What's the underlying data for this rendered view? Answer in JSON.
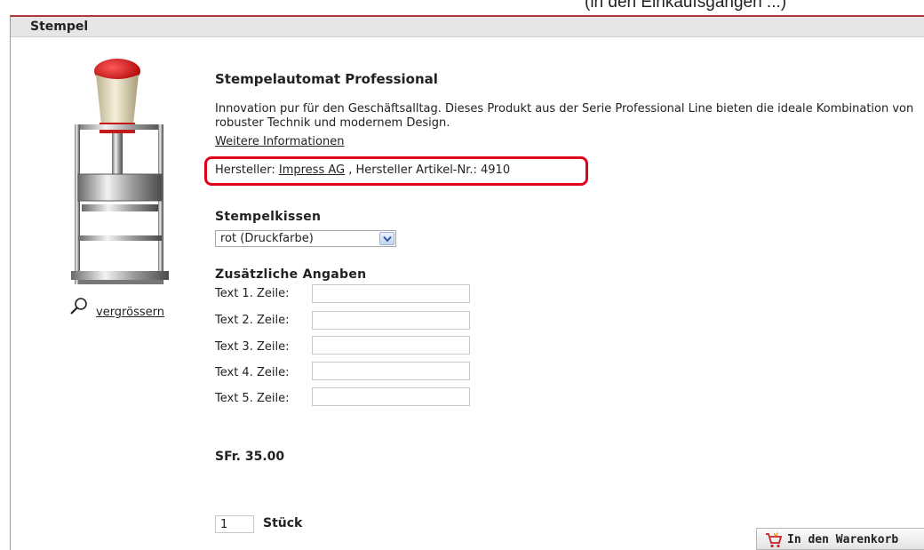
{
  "top_strip_text": "(in den Einkaufsgängen ...)",
  "section": {
    "title": "Stempel"
  },
  "product": {
    "title": "Stempelautomat Professional",
    "description": "Innovation pur für den Geschäftsalltag. Dieses Produkt aus der Serie Professional Line bieten die ideale Kombination von robuster Technik und modernem Design.",
    "more_info_label": "Weitere Informationen",
    "enlarge_label": "vergrössern",
    "image_icon": "rubber-stamp-image",
    "magnifier_icon": "magnifier-icon"
  },
  "manufacturer": {
    "label": "Hersteller:",
    "name": "Impress AG",
    "article_label": ", Hersteller Artikel-Nr.: 4910",
    "highlight_color": "#e0001a"
  },
  "ink_pad": {
    "heading": "Stempelkissen",
    "selected": "rot (Druckfarbe)"
  },
  "extra": {
    "heading": "Zusätzliche Angaben",
    "fields": [
      {
        "label": "Text 1. Zeile:",
        "value": ""
      },
      {
        "label": "Text 2. Zeile:",
        "value": ""
      },
      {
        "label": "Text 3. Zeile:",
        "value": ""
      },
      {
        "label": "Text 4. Zeile:",
        "value": ""
      },
      {
        "label": "Text 5. Zeile:",
        "value": ""
      }
    ]
  },
  "price": "SFr. 35.00",
  "quantity": {
    "value": "1",
    "unit": "Stück"
  },
  "cart_button": {
    "label": "In den Warenkorb",
    "icon": "shopping-cart-icon"
  }
}
